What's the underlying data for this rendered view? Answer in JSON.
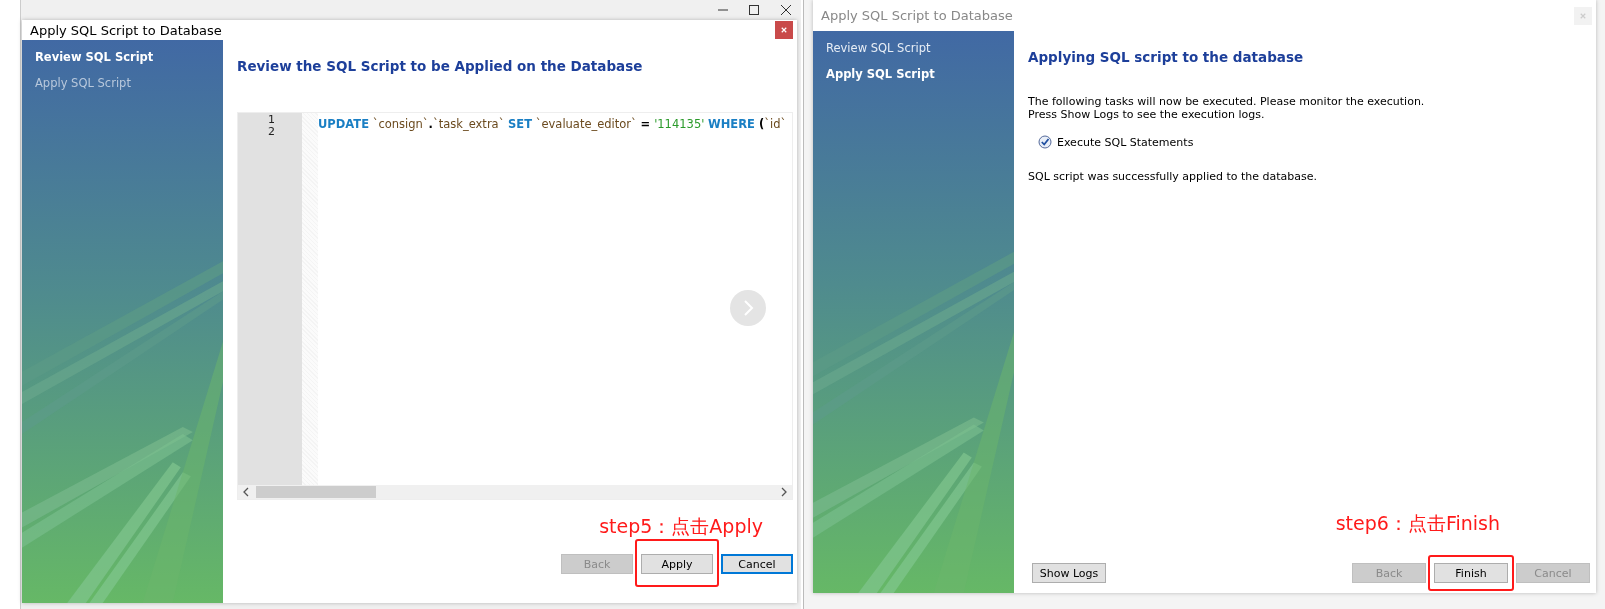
{
  "dialogs": [
    {
      "kind": "review",
      "title": "Apply SQL Script to Database",
      "active": true,
      "steps": [
        {
          "label": "Review SQL Script",
          "selected": true
        },
        {
          "label": "Apply SQL Script",
          "selected": false
        }
      ],
      "heading": "Review the SQL Script to be Applied on the Database",
      "editor": {
        "line_numbers": [
          "1",
          "2"
        ],
        "tokens": [
          {
            "text": "UPDATE",
            "kind": "keyword"
          },
          {
            "text": " `consign`",
            "kind": "identifier"
          },
          {
            "text": ".",
            "kind": "punct"
          },
          {
            "text": "`task_extra` ",
            "kind": "identifier"
          },
          {
            "text": "SET",
            "kind": "keyword"
          },
          {
            "text": " `evaluate_editor` ",
            "kind": "identifier"
          },
          {
            "text": "= ",
            "kind": "punct"
          },
          {
            "text": "'114135' ",
            "kind": "string"
          },
          {
            "text": "WHERE ",
            "kind": "keyword"
          },
          {
            "text": "(",
            "kind": "punct"
          },
          {
            "text": "`id`",
            "kind": "identifier"
          }
        ]
      },
      "annotation": "step5：点击Apply",
      "buttons": [
        {
          "label": "Back",
          "disabled": true,
          "focused": false,
          "highlighted": false,
          "kind": "nav"
        },
        {
          "label": "Apply",
          "disabled": false,
          "focused": false,
          "highlighted": true,
          "kind": "nav"
        },
        {
          "label": "Cancel",
          "disabled": false,
          "focused": true,
          "highlighted": false,
          "kind": "nav"
        }
      ]
    },
    {
      "kind": "apply",
      "title": "Apply SQL Script to Database",
      "active": false,
      "steps": [
        {
          "label": "Review SQL Script",
          "selected": false
        },
        {
          "label": "Apply SQL Script",
          "selected": true
        }
      ],
      "heading": "Applying SQL script to the database",
      "intro": [
        "The following tasks will now be executed. Please monitor the execution.",
        "Press Show Logs to see the execution logs."
      ],
      "tasks": [
        {
          "label": "Execute SQL Statements",
          "checked": true
        }
      ],
      "result": "SQL script was successfully applied to the database.",
      "annotation": "step6：点击Finish",
      "buttons": [
        {
          "label": "Show Logs",
          "disabled": false,
          "focused": false,
          "highlighted": false,
          "kind": "extra"
        },
        {
          "label": "Back",
          "disabled": true,
          "focused": false,
          "highlighted": false,
          "kind": "nav"
        },
        {
          "label": "Finish",
          "disabled": false,
          "focused": false,
          "highlighted": true,
          "kind": "nav"
        },
        {
          "label": "Cancel",
          "disabled": true,
          "focused": false,
          "highlighted": false,
          "kind": "nav"
        }
      ]
    }
  ]
}
